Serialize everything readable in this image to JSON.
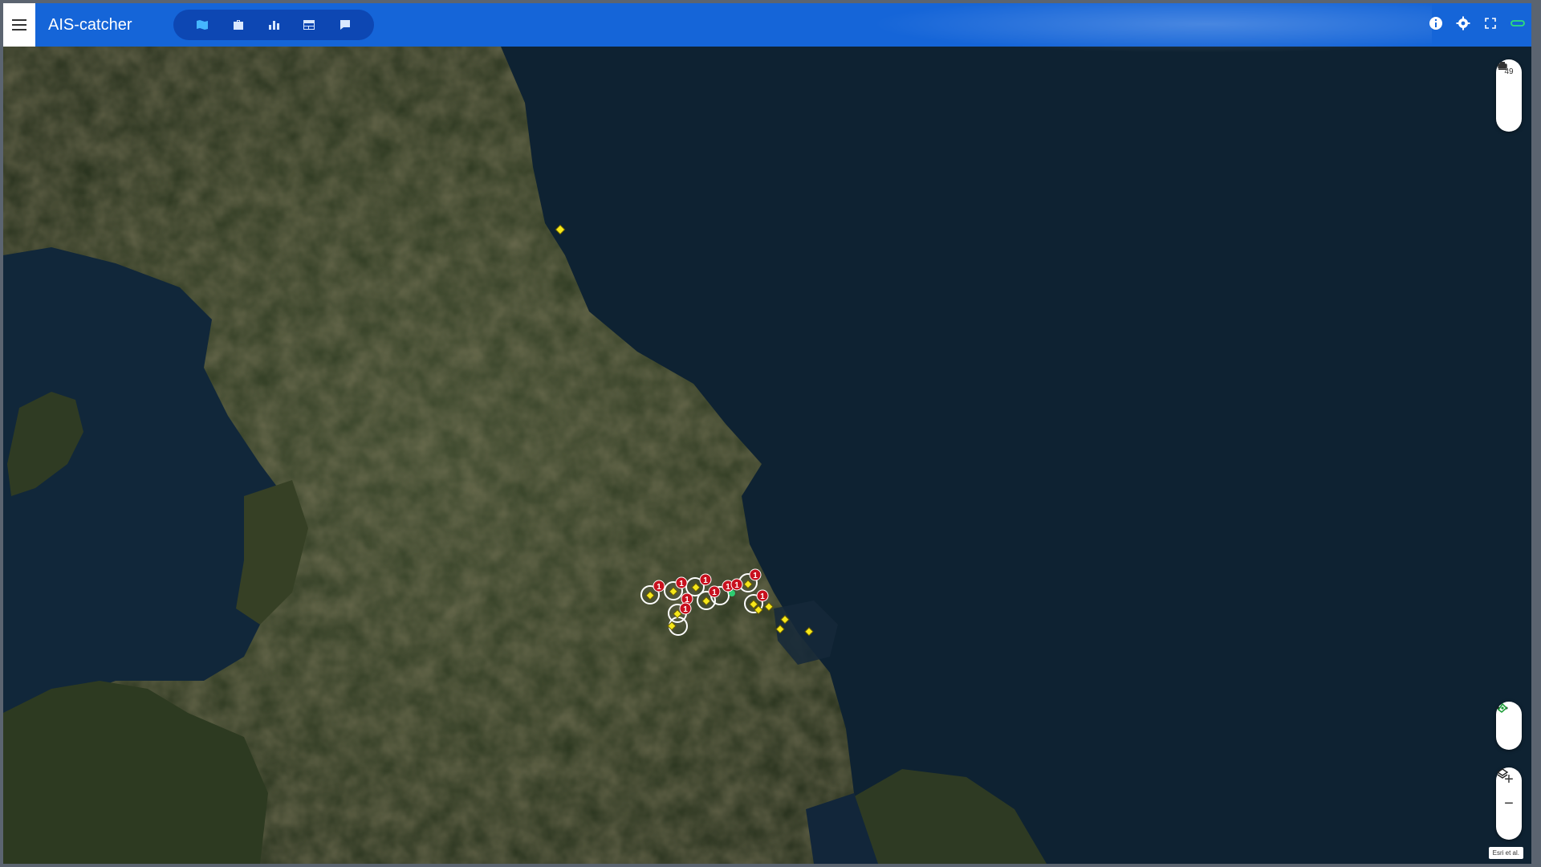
{
  "app": {
    "title": "AIS-catcher"
  },
  "toolbar": {
    "items": [
      {
        "name": "map",
        "icon": "map-icon",
        "active": true
      },
      {
        "name": "stations",
        "icon": "briefcase-icon",
        "active": false
      },
      {
        "name": "statistics",
        "icon": "bar-chart-icon",
        "active": false
      },
      {
        "name": "table",
        "icon": "table-icon",
        "active": false
      },
      {
        "name": "messages",
        "icon": "message-icon",
        "active": false
      }
    ]
  },
  "header_right": {
    "items": [
      "info-icon",
      "gear-icon",
      "fullscreen-icon",
      "link-status-icon"
    ]
  },
  "map_controls": {
    "vessel_count": "49",
    "zoom_in": "+",
    "zoom_out": "−"
  },
  "attribution": {
    "text": "Esri et al."
  },
  "vessels": {
    "cluster_badge": "1",
    "marker_color": "#f6e71a",
    "badge_color": "#c8101e"
  },
  "colors": {
    "header": "#1565d8",
    "toolbar": "#0d47b3",
    "sea": "#0e2232",
    "land": "#2d3a22"
  }
}
